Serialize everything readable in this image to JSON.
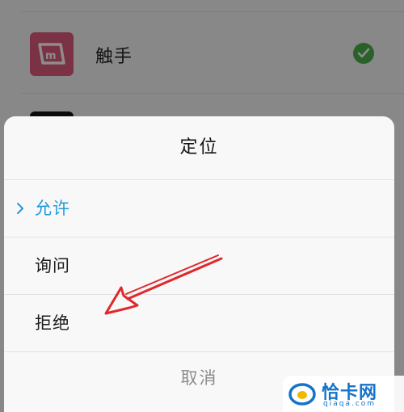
{
  "background_list": {
    "items": [
      {
        "name": "触手",
        "icon": "chushou-app-icon",
        "status_icon": "check-circle-icon",
        "status_color": "#4db14a"
      },
      {
        "name": "",
        "icon": "app-icon-dark"
      }
    ]
  },
  "sheet": {
    "title": "定位",
    "options": [
      {
        "label": "允许",
        "selected": true
      },
      {
        "label": "询问",
        "selected": false
      },
      {
        "label": "拒绝",
        "selected": false
      }
    ],
    "cancel_label": "取消",
    "accent_color": "#1e9be0"
  },
  "annotation": {
    "type": "red-arrow",
    "color": "#e0282c",
    "points_to": "拒绝"
  },
  "watermark": {
    "title": "恰卡网",
    "domain": "qiaqa.com"
  }
}
